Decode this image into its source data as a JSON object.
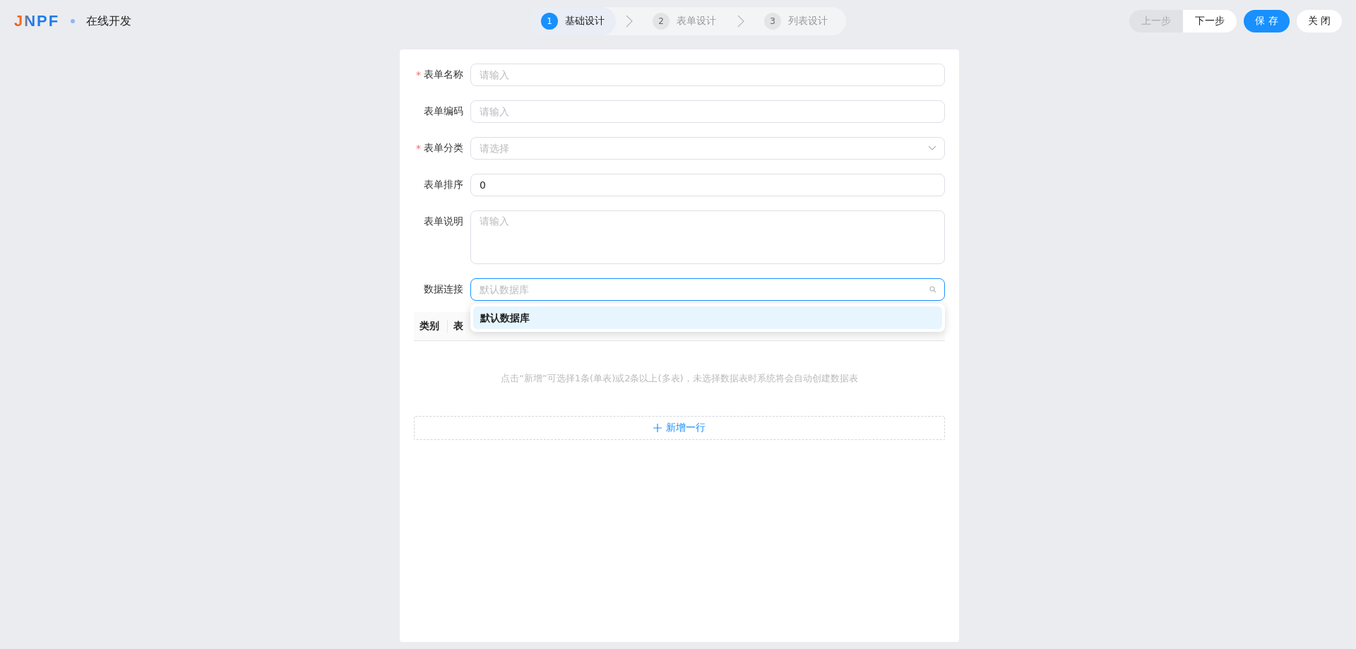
{
  "header": {
    "logo": "JNPF",
    "title": "在线开发"
  },
  "steps": [
    {
      "number": "1",
      "label": "基础设计",
      "selected": true
    },
    {
      "number": "2",
      "label": "表单设计",
      "selected": false
    },
    {
      "number": "3",
      "label": "列表设计",
      "selected": false
    }
  ],
  "actions": [
    {
      "label": "上一步",
      "kind": "plain",
      "disabled": true
    },
    {
      "label": "下一步",
      "kind": "plain",
      "disabled": false
    },
    {
      "label": "保 存",
      "kind": "primary",
      "disabled": false
    },
    {
      "label": "关 闭",
      "kind": "plain",
      "disabled": false
    }
  ],
  "form": [
    {
      "label": "表单名称",
      "required": true,
      "kind": "input",
      "placeholder": "请输入"
    },
    {
      "label": "表单编码",
      "required": false,
      "kind": "input",
      "placeholder": "请输入"
    },
    {
      "label": "表单分类",
      "required": true,
      "kind": "select",
      "placeholder": "请选择"
    },
    {
      "label": "表单排序",
      "required": false,
      "kind": "input",
      "value": "0"
    },
    {
      "label": "表单说明",
      "required": false,
      "kind": "textarea",
      "placeholder": "请输入"
    },
    {
      "label": "数据连接",
      "required": false,
      "kind": "search",
      "placeholder": "默认数据库",
      "focused": true
    }
  ],
  "dropdown": {
    "options": [
      {
        "label": "默认数据库",
        "selected": true
      }
    ]
  },
  "table": {
    "columns": [
      "类别",
      "表"
    ],
    "empty_text": "点击“新增”可选择1条(单表)或2条以上(多表)，未选择数据表时系统将会自动创建数据表"
  },
  "add_row": "新增一行",
  "required_mark": "*"
}
